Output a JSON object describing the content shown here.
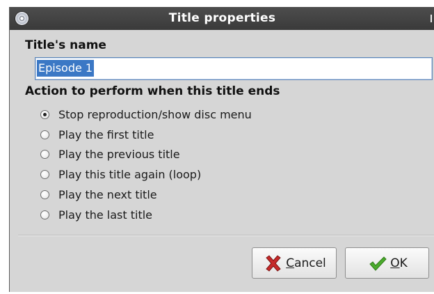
{
  "window": {
    "title": "Title properties"
  },
  "name_section": {
    "label": "Title's name",
    "value": "Episode 1"
  },
  "action_section": {
    "label": "Action to perform when this title ends",
    "selected_index": 0,
    "options": [
      "Stop reproduction/show disc menu",
      "Play the first title",
      "Play the previous title",
      "Play this title again (loop)",
      "Play the next title",
      "Play the last title"
    ]
  },
  "buttons": {
    "cancel": {
      "mnemonic": "C",
      "rest": "ancel",
      "icon": "cancel-x-icon"
    },
    "ok": {
      "mnemonic": "O",
      "rest": "K",
      "icon": "checkmark-icon"
    }
  },
  "colors": {
    "titlebar": "#3e3e3e",
    "dialog_bg": "#d6d6d6",
    "selection": "#3b78c5",
    "cancel_icon": "#c62a2a",
    "ok_icon": "#4bab2d"
  }
}
